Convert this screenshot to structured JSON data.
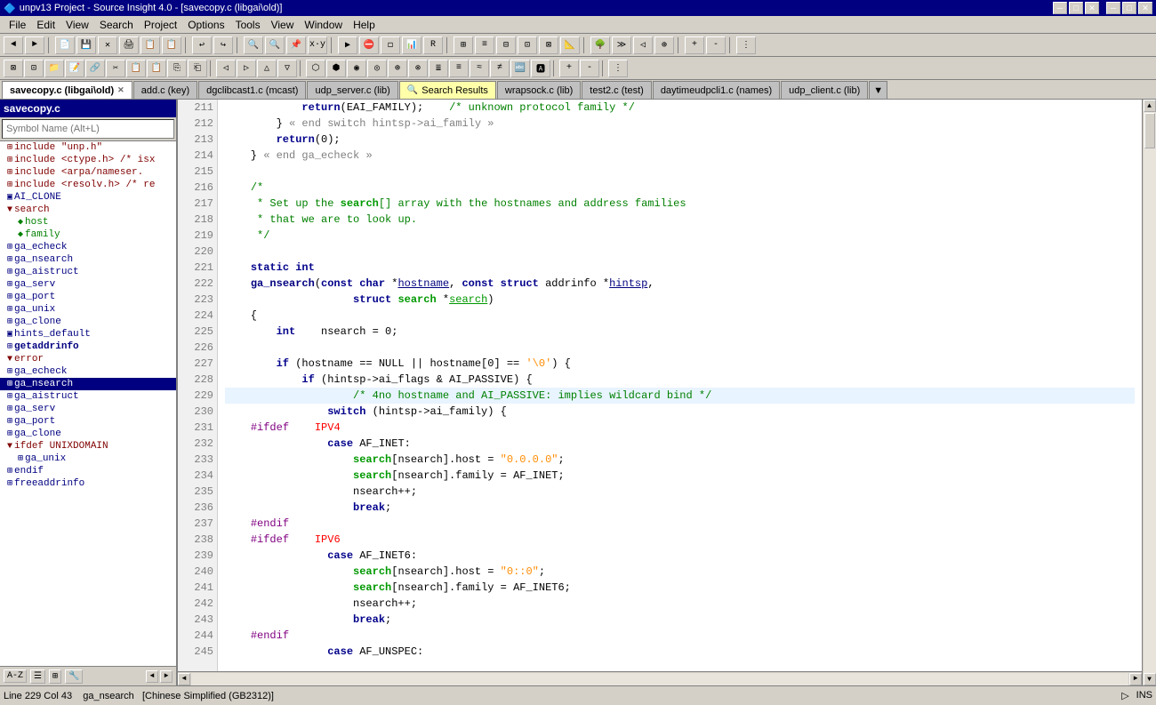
{
  "titleBar": {
    "icon": "🔷",
    "title": "unpv13 Project - Source Insight 4.0 - [savecopy.c (libgai\\old)]",
    "minimize": "─",
    "maximize": "□",
    "close": "✕",
    "winMinimize": "─",
    "winMaximize": "□",
    "winClose": "✕"
  },
  "menuBar": {
    "items": [
      "File",
      "Edit",
      "View",
      "Search",
      "Project",
      "Options",
      "Tools",
      "View",
      "Window",
      "Help"
    ]
  },
  "tabs": [
    {
      "label": "savecopy.c (libgai\\old)",
      "active": true,
      "closeable": true
    },
    {
      "label": "add.c (key)",
      "active": false,
      "closeable": false
    },
    {
      "label": "dgclibcast1.c (mcast)",
      "active": false,
      "closeable": false
    },
    {
      "label": "udp_server.c (lib)",
      "active": false,
      "closeable": false
    },
    {
      "label": "Search Results",
      "active": false,
      "closeable": false,
      "search": true
    },
    {
      "label": "wrapsock.c (lib)",
      "active": false,
      "closeable": false
    },
    {
      "label": "test2.c (test)",
      "active": false,
      "closeable": false
    },
    {
      "label": "daytimeudpcli1.c (names)",
      "active": false,
      "closeable": false
    },
    {
      "label": "udp_client.c (lib)",
      "active": false,
      "closeable": false
    }
  ],
  "sidebar": {
    "header": "savecopy.c",
    "symbolInputPlaceholder": "Symbol Name (Alt+L)",
    "items": [
      {
        "id": "include-unh",
        "label": "include \"unp.h\"",
        "level": 1,
        "icon": "⊞",
        "color": "#800000"
      },
      {
        "id": "include-ctype",
        "label": "include <ctype.h> /* isx",
        "level": 1,
        "icon": "⊞",
        "color": "#800000"
      },
      {
        "id": "include-arpa",
        "label": "include <arpa/nameser.",
        "level": 1,
        "icon": "⊞",
        "color": "#800000"
      },
      {
        "id": "include-resolv",
        "label": "include <resolv.h> /* re",
        "level": 1,
        "icon": "⊞",
        "color": "#800000"
      },
      {
        "id": "ai-clone",
        "label": "AI_CLONE",
        "level": 1,
        "icon": "▣",
        "color": "#000080"
      },
      {
        "id": "search",
        "label": "search",
        "level": 1,
        "icon": "▼",
        "expanded": true,
        "color": "#800000"
      },
      {
        "id": "host",
        "label": "host",
        "level": 2,
        "icon": "◆",
        "color": "#008000"
      },
      {
        "id": "family",
        "label": "family",
        "level": 2,
        "icon": "◆",
        "color": "#008000"
      },
      {
        "id": "ga-echeck",
        "label": "ga_echeck",
        "level": 1,
        "icon": "⊞",
        "color": "#000080"
      },
      {
        "id": "ga-nsearch",
        "label": "ga_nsearch",
        "level": 1,
        "icon": "⊞",
        "color": "#000080"
      },
      {
        "id": "ga-aistruct",
        "label": "ga_aistruct",
        "level": 1,
        "icon": "⊞",
        "color": "#000080"
      },
      {
        "id": "ga-serv",
        "label": "ga_serv",
        "level": 1,
        "icon": "⊞",
        "color": "#000080"
      },
      {
        "id": "ga-port",
        "label": "ga_port",
        "level": 1,
        "icon": "⊞",
        "color": "#000080"
      },
      {
        "id": "ga-unix",
        "label": "ga_unix",
        "level": 1,
        "icon": "⊞",
        "color": "#000080"
      },
      {
        "id": "ga-clone",
        "label": "ga_clone",
        "level": 1,
        "icon": "⊞",
        "color": "#000080"
      },
      {
        "id": "hints-default",
        "label": "hints_default",
        "level": 1,
        "icon": "▣",
        "color": "#000080"
      },
      {
        "id": "getaddrinfo",
        "label": "getaddrinfo",
        "level": 1,
        "icon": "⊞",
        "color": "#000080",
        "bold": true
      },
      {
        "id": "error",
        "label": "error",
        "level": 1,
        "icon": "▼",
        "expanded": true,
        "color": "#800000"
      },
      {
        "id": "ga-echeck2",
        "label": "ga_echeck",
        "level": 1,
        "icon": "⊞",
        "color": "#000080"
      },
      {
        "id": "ga-nsearch2",
        "label": "ga_nsearch",
        "level": 1,
        "icon": "⊞",
        "color": "#000080",
        "selected": true
      },
      {
        "id": "ga-aistruct2",
        "label": "ga_aistruct",
        "level": 1,
        "icon": "⊞",
        "color": "#000080"
      },
      {
        "id": "ga-serv2",
        "label": "ga_serv",
        "level": 1,
        "icon": "⊞",
        "color": "#000080"
      },
      {
        "id": "ga-port2",
        "label": "ga_port",
        "level": 1,
        "icon": "⊞",
        "color": "#000080"
      },
      {
        "id": "ga-clone2",
        "label": "ga_clone",
        "level": 1,
        "icon": "⊞",
        "color": "#000080"
      },
      {
        "id": "ifdef-unix",
        "label": "ifdef UNIXDOMAIN",
        "level": 1,
        "icon": "▼",
        "expanded": true,
        "color": "#800000"
      },
      {
        "id": "ga-unix2",
        "label": "ga_unix",
        "level": 2,
        "icon": "⊞",
        "color": "#000080"
      },
      {
        "id": "endif",
        "label": "endif",
        "level": 1,
        "icon": "⊞",
        "color": "#000080"
      },
      {
        "id": "freeaddrinfo",
        "label": "freeaddrinfo",
        "level": 1,
        "icon": "⊞",
        "color": "#000080"
      }
    ]
  },
  "code": {
    "lines": [
      {
        "num": 211,
        "text": "            return(EAI_FAMILY);    /* unknown protocol family */"
      },
      {
        "num": 212,
        "text": "        } « end switch hintsp->ai_family »"
      },
      {
        "num": 213,
        "text": "        return(0);"
      },
      {
        "num": 214,
        "text": "    } « end ga_echeck »"
      },
      {
        "num": 215,
        "text": ""
      },
      {
        "num": 216,
        "text": "    /*"
      },
      {
        "num": 217,
        "text": "     * Set up the search[] array with the hostnames and address families"
      },
      {
        "num": 218,
        "text": "     * that we are to look up."
      },
      {
        "num": 219,
        "text": "     */"
      },
      {
        "num": 220,
        "text": ""
      },
      {
        "num": 221,
        "text": "    static int"
      },
      {
        "num": 222,
        "text": "    ga_nsearch(const char *hostname, const struct addrinfo *hintsp,"
      },
      {
        "num": 223,
        "text": "                struct search *search)"
      },
      {
        "num": 224,
        "text": "    {"
      },
      {
        "num": 225,
        "text": "        int    nsearch = 0;"
      },
      {
        "num": 226,
        "text": ""
      },
      {
        "num": 227,
        "text": "        if (hostname == NULL || hostname[0] == '\\0') {"
      },
      {
        "num": 228,
        "text": "            if (hintsp->ai_flags & AI_PASSIVE) {"
      },
      {
        "num": 229,
        "text": "                    /* 4no hostname and AI_PASSIVE: implies wildcard bind */"
      },
      {
        "num": 230,
        "text": "                switch (hintsp->ai_family) {"
      },
      {
        "num": 231,
        "text": "    #ifdef    IPV4"
      },
      {
        "num": 232,
        "text": "                case AF_INET:"
      },
      {
        "num": 233,
        "text": "                    search[nsearch].host = \"0.0.0.0\";"
      },
      {
        "num": 234,
        "text": "                    search[nsearch].family = AF_INET;"
      },
      {
        "num": 235,
        "text": "                    nsearch++;"
      },
      {
        "num": 236,
        "text": "                    break;"
      },
      {
        "num": 237,
        "text": "    #endif"
      },
      {
        "num": 238,
        "text": "    #ifdef    IPV6"
      },
      {
        "num": 239,
        "text": "                case AF_INET6:"
      },
      {
        "num": 240,
        "text": "                    search[nsearch].host = \"0::0\";"
      },
      {
        "num": 241,
        "text": "                    search[nsearch].family = AF_INET6;"
      },
      {
        "num": 242,
        "text": "                    nsearch++;"
      },
      {
        "num": 243,
        "text": "                    break;"
      },
      {
        "num": 244,
        "text": "    #endif"
      },
      {
        "num": 245,
        "text": "                case AF_UNSPEC:"
      }
    ]
  },
  "statusBar": {
    "position": "Line 229  Col 43",
    "function": "ga_nsearch",
    "encoding": "[Chinese Simplified (GB2312)]",
    "mode": "INS",
    "cursorIcon": "▷"
  },
  "sidebarBottom": {
    "azButton": "A-Z",
    "icons": [
      "☰",
      "⊞",
      "🔧"
    ]
  }
}
